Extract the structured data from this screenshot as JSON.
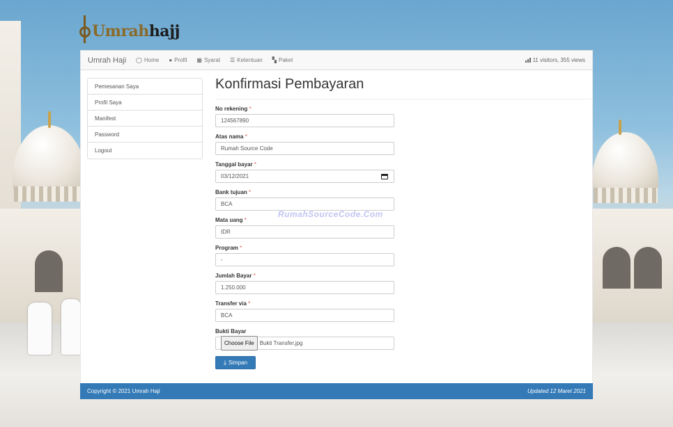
{
  "logo": {
    "text_a": "Umrah",
    "text_b": "hajj"
  },
  "navbar": {
    "brand": "Umrah Haji",
    "items": [
      {
        "label": "Home",
        "icon": "home-icon",
        "glyph": "◯"
      },
      {
        "label": "Profil",
        "icon": "info-icon",
        "glyph": "●"
      },
      {
        "label": "Syarat",
        "icon": "grid-icon",
        "glyph": "▦"
      },
      {
        "label": "Ketentuan",
        "icon": "list-icon",
        "glyph": "☰"
      },
      {
        "label": "Paket",
        "icon": "tiles-icon",
        "glyph": "▚"
      }
    ],
    "stats": "11 visitors, 355 views",
    "stats_icon": "stats-icon"
  },
  "sidebar": {
    "items": [
      {
        "label": "Pemesanan Saya"
      },
      {
        "label": "Profil Saya"
      },
      {
        "label": "Manifest"
      },
      {
        "label": "Password"
      },
      {
        "label": "Logout"
      }
    ]
  },
  "form": {
    "title": "Konfirmasi Pembayaran",
    "fields": [
      {
        "label": "No rekening",
        "required": "*",
        "value": "124567890",
        "type": "text"
      },
      {
        "label": "Atas nama",
        "required": "*",
        "value": "Rumah Source Code",
        "type": "text"
      },
      {
        "label": "Tanggal bayar",
        "required": "*",
        "value": "03/12/2021",
        "type": "date"
      },
      {
        "label": "Bank tujuan",
        "required": "*",
        "value": "BCA",
        "type": "text"
      },
      {
        "label": "Mata uang",
        "required": "*",
        "value": "IDR",
        "type": "text"
      },
      {
        "label": "Program",
        "required": "*",
        "value": "-",
        "type": "text"
      },
      {
        "label": "Jumlah Bayar",
        "required": "*",
        "value": "1.250.000",
        "type": "text"
      },
      {
        "label": "Transfer via",
        "required": "*",
        "value": "BCA",
        "type": "text"
      },
      {
        "label": "Bukti Bayar",
        "required": "",
        "value": "Bukti Transfer.jpg",
        "button": "Choose File",
        "type": "file"
      }
    ],
    "submit_label": "Simpan"
  },
  "watermark": "RumahSourceCode.Com",
  "footer": {
    "copyright": "Copyright © 2021 Umrah Haji",
    "updated": "Updated 12 Maret 2021"
  },
  "colors": {
    "primary": "#337ab7",
    "required": "#d9534f",
    "logo_gold": "#8a6a2a"
  }
}
